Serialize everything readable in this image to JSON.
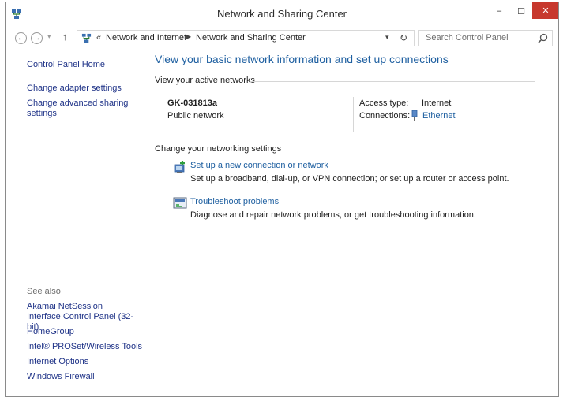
{
  "window": {
    "title": "Network and Sharing Center",
    "minimize_glyph": "–",
    "maximize_glyph": "☐",
    "close_glyph": "✕",
    "close_color": "#c7382d"
  },
  "address": {
    "back_glyph": "←",
    "forward_glyph": "→",
    "up_glyph": "↑",
    "overflow_glyph": "«",
    "crumbs": [
      "Network and Internet",
      "Network and Sharing Center"
    ],
    "search_placeholder": "Search Control Panel"
  },
  "left_pane": {
    "home": "Control Panel Home",
    "adapter": "Change adapter settings",
    "advanced_sharing": "Change advanced sharing settings",
    "see_also_header": "See also",
    "see_also": [
      "Akamai NetSession Interface Control Panel (32-bit)",
      "HomeGroup",
      "Intel® PROSet/Wireless Tools",
      "Internet Options",
      "Windows Firewall"
    ]
  },
  "main": {
    "heading": "View your basic network information and set up connections",
    "active_networks_header": "View your active networks",
    "network": {
      "name": "GK-031813a",
      "type": "Public network",
      "access_type_label": "Access type:",
      "access_type_value": "Internet",
      "connections_label": "Connections:",
      "connection_name": "Ethernet"
    },
    "change_settings_header": "Change your networking settings",
    "tasks": [
      {
        "icon": "new-connection-icon",
        "link": "Set up a new connection or network",
        "description": "Set up a broadband, dial-up, or VPN connection; or set up a router or access point."
      },
      {
        "icon": "troubleshoot-icon",
        "link": "Troubleshoot problems",
        "description": "Diagnose and repair network problems, or get troubleshooting information."
      }
    ],
    "link_color": "#1e5fa0"
  }
}
